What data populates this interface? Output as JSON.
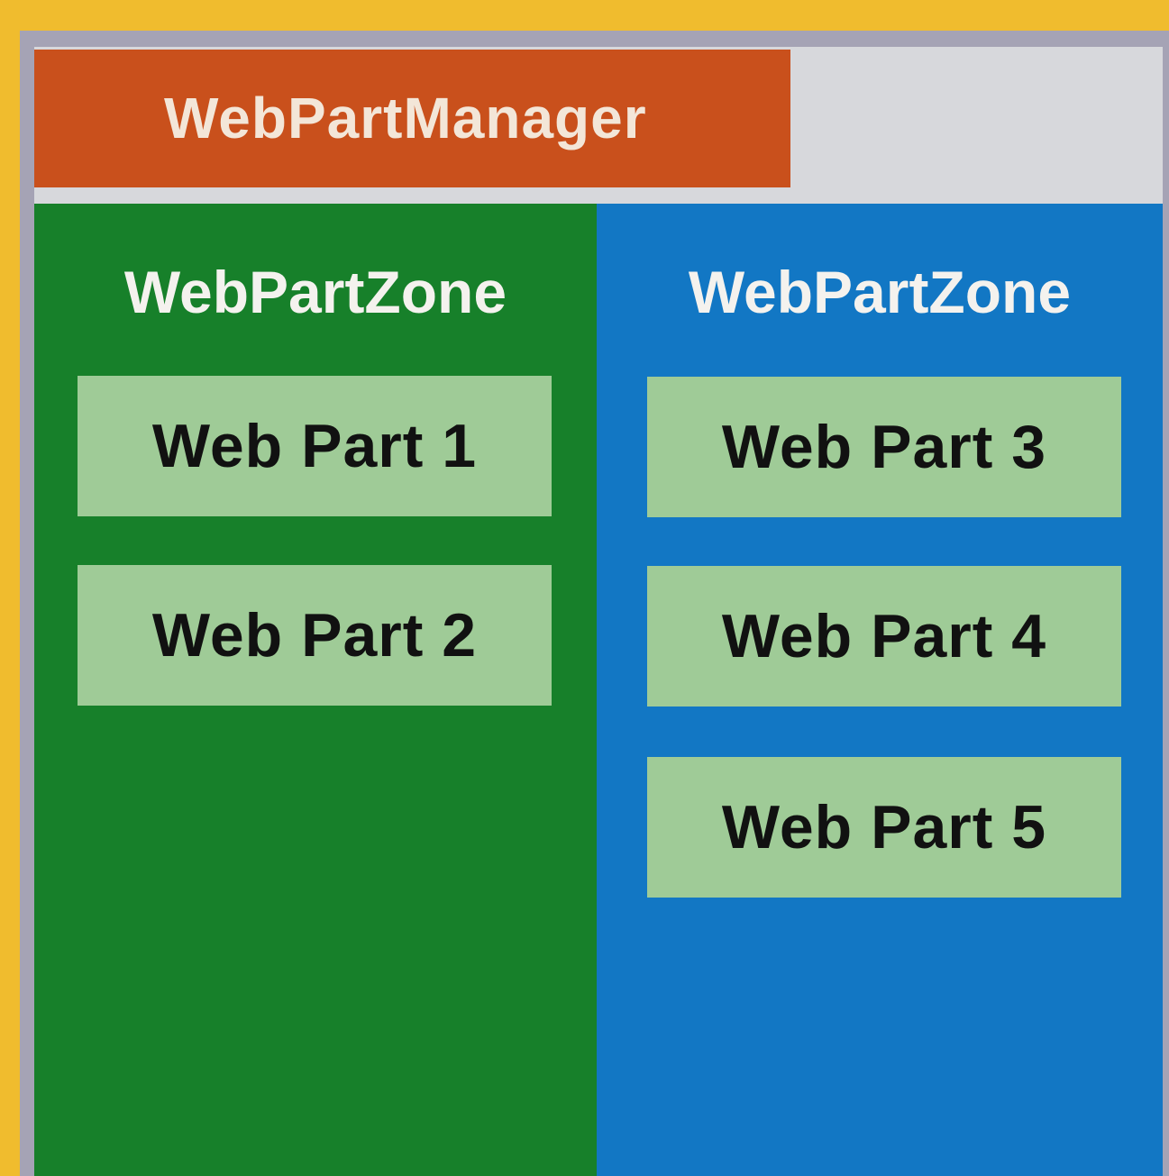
{
  "colors": {
    "background": "#f0bc2e",
    "manager": "#c9501c",
    "zone_left": "#17802a",
    "zone_right": "#1277c4",
    "web_part": "#9fcb97"
  },
  "manager": {
    "label": "WebPartManager"
  },
  "zones": [
    {
      "title": "WebPartZone",
      "parts": [
        "Web Part 1",
        "Web Part 2"
      ]
    },
    {
      "title": "WebPartZone",
      "parts": [
        "Web Part 3",
        "Web Part 4",
        "Web Part 5"
      ]
    }
  ]
}
